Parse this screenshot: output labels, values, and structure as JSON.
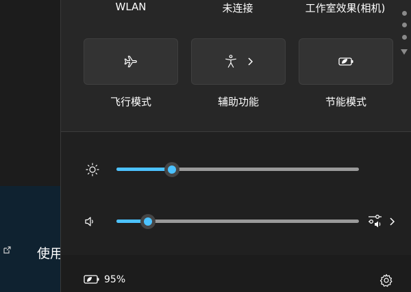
{
  "background_window": {
    "partial_text": "使用"
  },
  "quick_settings": {
    "top_labels": {
      "wlan": "WLAN",
      "bluetooth": "未连接",
      "studio_effects": "工作室效果(相机)"
    },
    "tiles": [
      {
        "id": "airplane",
        "label": "飞行模式",
        "icon": "airplane-icon"
      },
      {
        "id": "accessibility",
        "label": "辅助功能",
        "icon": "accessibility-icon"
      },
      {
        "id": "energy_saver",
        "label": "节能模式",
        "icon": "energy-saver-icon"
      }
    ],
    "brightness": {
      "icon": "brightness-icon",
      "level": 0.23
    },
    "volume": {
      "icon": "speaker-icon",
      "level": 0.13
    },
    "battery": {
      "icon": "battery-icon",
      "percent_label": "95%"
    },
    "settings_icon": "gear-icon",
    "accent_color": "#4cc2ff"
  }
}
